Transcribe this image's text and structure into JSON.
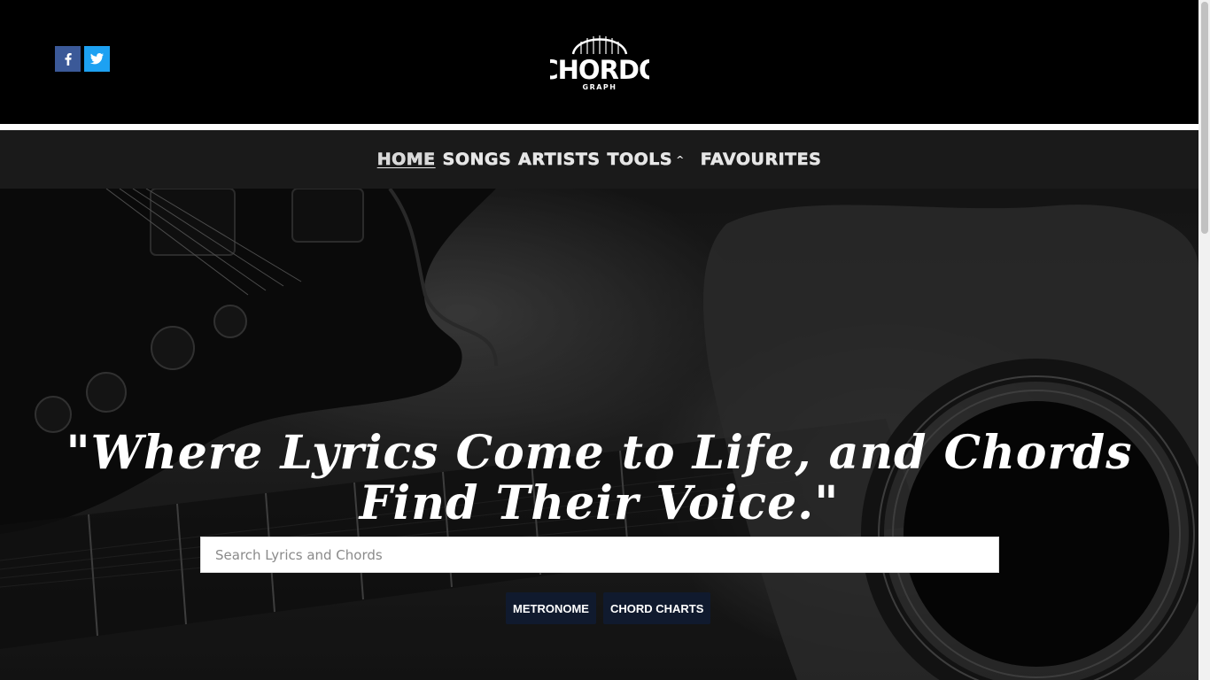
{
  "social": {
    "facebook_icon": "facebook-icon",
    "twitter_icon": "twitter-icon",
    "facebook_color": "#3b5998",
    "twitter_color": "#1da1f2"
  },
  "logo": {
    "line1": "CHORDO",
    "line2": "GRAPH"
  },
  "nav": {
    "home": "HOME",
    "songs": "SONGS",
    "artists": "ARTISTS",
    "tools": "TOOLS",
    "tools_caret": "^",
    "favourites": "FAVOURITES"
  },
  "hero": {
    "tagline": "\"Where Lyrics Come to Life, and Chords Find Their Voice.\"",
    "search_placeholder": "Search Lyrics and Chords",
    "buttons": {
      "metronome": "METRONOME",
      "chord_charts": "CHORD CHARTS"
    },
    "button_color": "#101a2e"
  }
}
